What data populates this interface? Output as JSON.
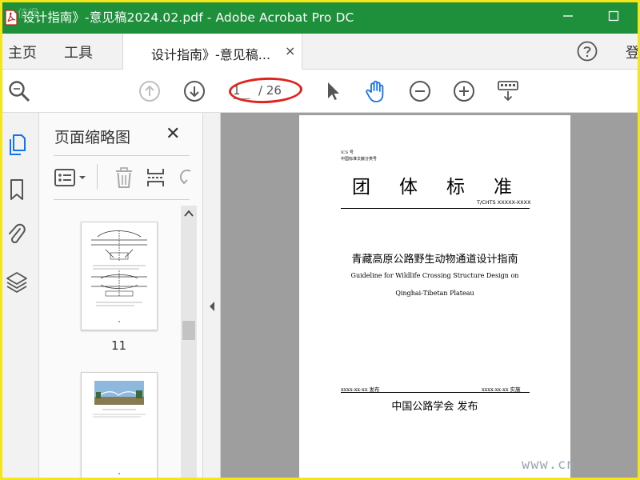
{
  "window": {
    "title": "设计指南》-意见稿2024.02.pdf - Adobe Acrobat Pro DC",
    "watermark_top": "值得"
  },
  "menu": {
    "home": "主页",
    "tools": "工具",
    "login": "登"
  },
  "tab": {
    "label": "设计指南》-意见稿...",
    "close": "×"
  },
  "toolbar": {
    "page_current": "1",
    "page_total": "/ 26"
  },
  "thumbnail_panel": {
    "title": "页面缩略图",
    "close": "✕",
    "page_number": "11"
  },
  "document": {
    "ics": "ICS 号",
    "classification": "中国标准文献分类号",
    "heading_chars": [
      "团",
      "体",
      "标",
      "准"
    ],
    "standard_number": "T/CHTS XXXXX-XXXX",
    "title_cn": "青藏高原公路野生动物通道设计指南",
    "title_en_line1": "Guideline for Wildlife Crossing Structure Design on",
    "title_en_line2": "Qinghai-Tibetan Plateau",
    "issue_date": "xxxx-xx-xx 发布",
    "implement_date": "xxxx-xx-xx 实施",
    "publisher": "中国公路学会  发布"
  },
  "watermark_bottom": "www.cn",
  "colors": {
    "titlebar": "#1e8f3a",
    "frame": "#f5e61a",
    "annotation": "#e0221c",
    "accent": "#1473e6"
  }
}
